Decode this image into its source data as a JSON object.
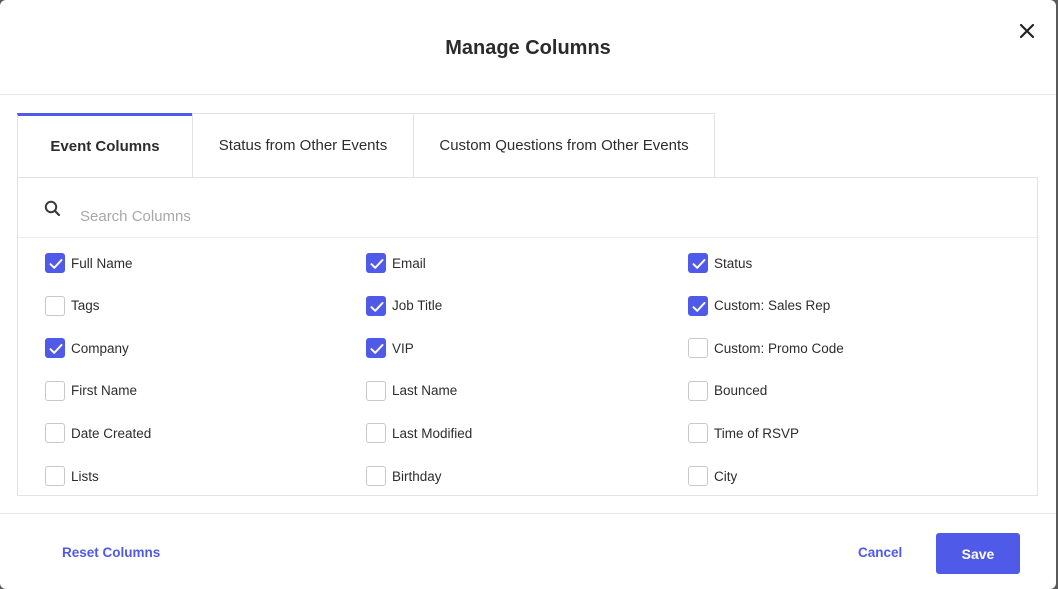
{
  "modal": {
    "title": "Manage Columns",
    "close_icon": "close-icon"
  },
  "tabs": [
    {
      "label": "Event Columns",
      "active": true
    },
    {
      "label": "Status from Other Events",
      "active": false
    },
    {
      "label": "Custom Questions from Other Events",
      "active": false
    }
  ],
  "search": {
    "placeholder": "Search Columns",
    "value": "",
    "icon": "search-icon"
  },
  "columns": [
    {
      "label": "Full Name",
      "checked": true
    },
    {
      "label": "Email",
      "checked": true
    },
    {
      "label": "Status",
      "checked": true
    },
    {
      "label": "Tags",
      "checked": false
    },
    {
      "label": "Job Title",
      "checked": true
    },
    {
      "label": "Custom: Sales Rep",
      "checked": true
    },
    {
      "label": "Company",
      "checked": true
    },
    {
      "label": "VIP",
      "checked": true
    },
    {
      "label": "Custom: Promo Code",
      "checked": false
    },
    {
      "label": "First Name",
      "checked": false
    },
    {
      "label": "Last Name",
      "checked": false
    },
    {
      "label": "Bounced",
      "checked": false
    },
    {
      "label": "Date Created",
      "checked": false
    },
    {
      "label": "Last Modified",
      "checked": false
    },
    {
      "label": "Time of RSVP",
      "checked": false
    },
    {
      "label": "Lists",
      "checked": false
    },
    {
      "label": "Birthday",
      "checked": false
    },
    {
      "label": "City",
      "checked": false
    }
  ],
  "footer": {
    "reset_label": "Reset Columns",
    "cancel_label": "Cancel",
    "save_label": "Save"
  },
  "colors": {
    "accent": "#4f5ae8"
  }
}
